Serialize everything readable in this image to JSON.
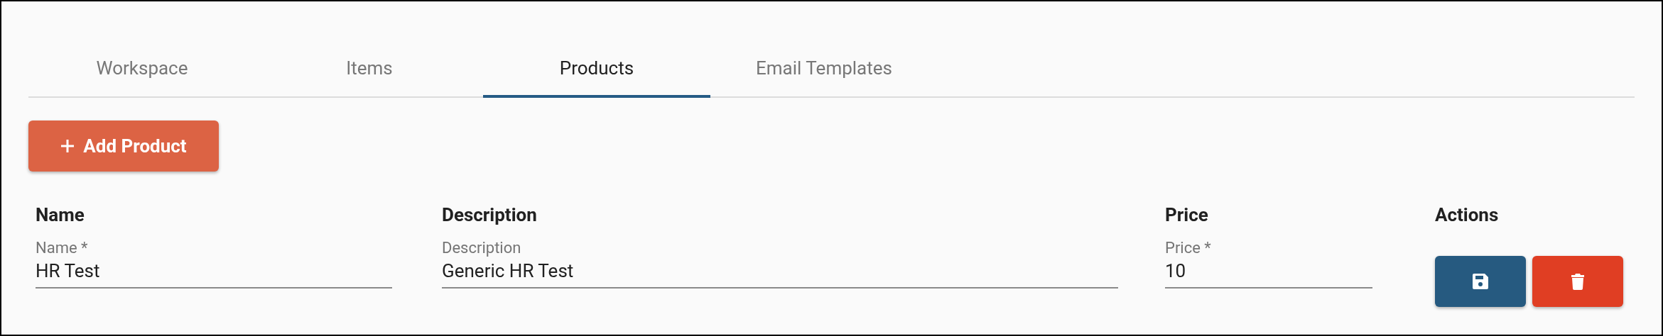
{
  "tabs": [
    {
      "label": "Workspace",
      "selected": false
    },
    {
      "label": "Items",
      "selected": false
    },
    {
      "label": "Products",
      "selected": true
    },
    {
      "label": "Email Templates",
      "selected": false
    }
  ],
  "add_button": {
    "label": "Add Product"
  },
  "table": {
    "columns": [
      "Name",
      "Description",
      "Price",
      "Actions"
    ],
    "rows": [
      {
        "fields": [
          {
            "label": "Name *",
            "value": "HR Test"
          },
          {
            "label": "Description",
            "value": "Generic HR Test"
          },
          {
            "label": "Price *",
            "value": "10"
          }
        ]
      }
    ]
  }
}
